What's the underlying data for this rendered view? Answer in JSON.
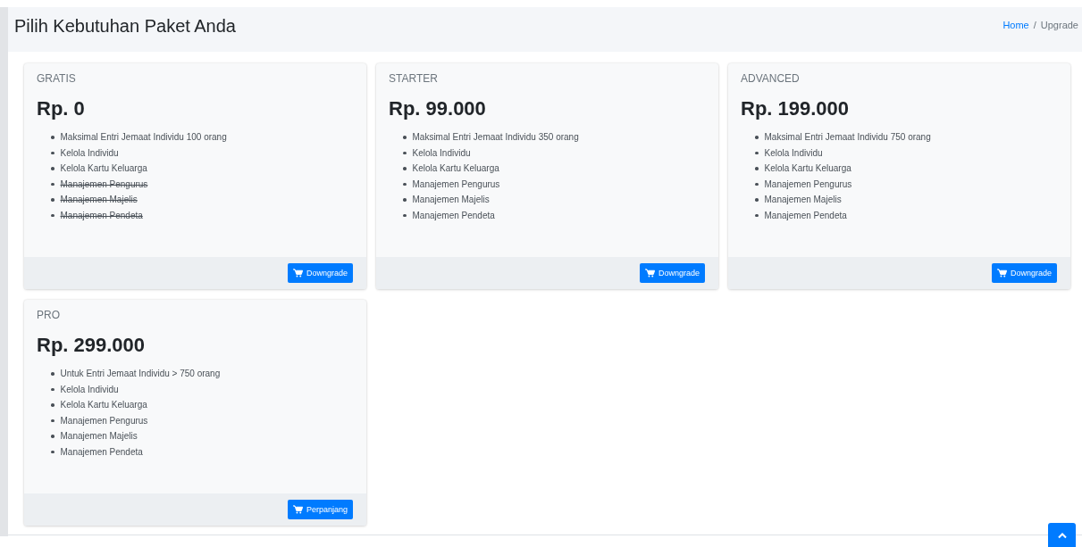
{
  "header": {
    "title": "Pilih Kebutuhan Paket Anda",
    "breadcrumb": [
      {
        "label": "Home",
        "link": true
      },
      {
        "label": "Upgrade",
        "link": false
      }
    ],
    "separator": "/"
  },
  "plans": [
    {
      "name": "GRATIS",
      "price": "Rp. 0",
      "features": [
        {
          "text": "Maksimal Entri Jemaat Individu 100 orang",
          "struck": false
        },
        {
          "text": "Kelola Individu",
          "struck": false
        },
        {
          "text": "Kelola Kartu Keluarga",
          "struck": false
        },
        {
          "text": "Manajemen Pengurus",
          "struck": true
        },
        {
          "text": "Manajemen Majelis",
          "struck": true
        },
        {
          "text": "Manajemen Pendeta",
          "struck": true
        }
      ],
      "button": "Downgrade"
    },
    {
      "name": "STARTER",
      "price": "Rp. 99.000",
      "features": [
        {
          "text": "Maksimal Entri Jemaat Individu 350 orang",
          "struck": false
        },
        {
          "text": "Kelola Individu",
          "struck": false
        },
        {
          "text": "Kelola Kartu Keluarga",
          "struck": false
        },
        {
          "text": "Manajemen Pengurus",
          "struck": false
        },
        {
          "text": "Manajemen Majelis",
          "struck": false
        },
        {
          "text": "Manajemen Pendeta",
          "struck": false
        }
      ],
      "button": "Downgrade"
    },
    {
      "name": "ADVANCED",
      "price": "Rp. 199.000",
      "features": [
        {
          "text": "Maksimal Entri Jemaat Individu 750 orang",
          "struck": false
        },
        {
          "text": "Kelola Individu",
          "struck": false
        },
        {
          "text": "Kelola Kartu Keluarga",
          "struck": false
        },
        {
          "text": "Manajemen Pengurus",
          "struck": false
        },
        {
          "text": "Manajemen Majelis",
          "struck": false
        },
        {
          "text": "Manajemen Pendeta",
          "struck": false
        }
      ],
      "button": "Downgrade"
    },
    {
      "name": "PRO",
      "price": "Rp. 299.000",
      "features": [
        {
          "text": "Untuk Entri Jemaat Individu > 750 orang",
          "struck": false
        },
        {
          "text": "Kelola Individu",
          "struck": false
        },
        {
          "text": "Kelola Kartu Keluarga",
          "struck": false
        },
        {
          "text": "Manajemen Pengurus",
          "struck": false
        },
        {
          "text": "Manajemen Majelis",
          "struck": false
        },
        {
          "text": "Manajemen Pendeta",
          "struck": false
        }
      ],
      "button": "Perpanjang"
    }
  ]
}
